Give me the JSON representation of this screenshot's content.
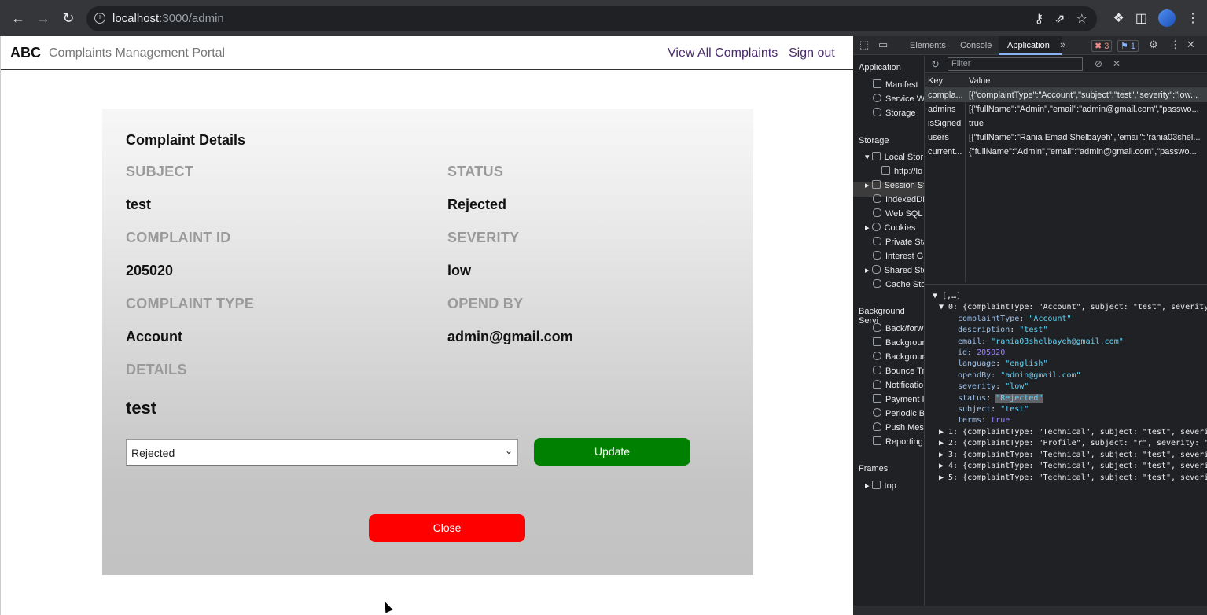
{
  "browser": {
    "url_host": "localhost",
    "url_rest": ":3000/admin"
  },
  "nav": {
    "brand": "ABC",
    "subtitle": "Complaints Management Portal",
    "view_all": "View All Complaints",
    "sign_out": "Sign out"
  },
  "details": {
    "title": "Complaint Details",
    "subject_label": "SUBJECT",
    "subject": "test",
    "status_label": "STATUS",
    "status": "Rejected",
    "id_label": "COMPLAINT ID",
    "id": "205020",
    "severity_label": "SEVERITY",
    "severity": "low",
    "type_label": "COMPLAINT TYPE",
    "type": "Account",
    "opened_label": "OPEND BY",
    "opened_by": "admin@gmail.com",
    "details_label": "DETAILS",
    "details": "test",
    "status_select": "Rejected",
    "update_label": "Update",
    "close_label": "Close"
  },
  "devtools": {
    "tabs": [
      "Elements",
      "Console",
      "Application"
    ],
    "errors": "3",
    "messages": "1",
    "filter_placeholder": "Filter",
    "side": {
      "application": "Application",
      "manifest": "Manifest",
      "service_workers": "Service W",
      "storage_item": "Storage",
      "storage": "Storage",
      "local_storage": "Local Stor",
      "local_origin": "http://lo",
      "session": "Session St",
      "indexeddb": "IndexedDI",
      "websql": "Web SQL",
      "cookies": "Cookies",
      "private": "Private Sta",
      "interest": "Interest G",
      "shared": "Shared Sto",
      "cache": "Cache Sto",
      "background": "Background Servi",
      "back_forward": "Back/forw",
      "bg_fetch": "Backgroun",
      "bg_sync": "Backgroun",
      "bounce": "Bounce Tr",
      "notifications": "Notificatio",
      "payment": "Payment I",
      "periodic": "Periodic B",
      "push": "Push Mes",
      "reporting": "Reporting",
      "frames": "Frames",
      "top": "top"
    },
    "kv_head": {
      "key": "Key",
      "value": "Value"
    },
    "kv": [
      {
        "key": "compla...",
        "value": "[{\"complaintType\":\"Account\",\"subject\":\"test\",\"severity\":\"low..."
      },
      {
        "key": "admins",
        "value": "[{\"fullName\":\"Admin\",\"email\":\"admin@gmail.com\",\"passwo..."
      },
      {
        "key": "isSigned",
        "value": "true"
      },
      {
        "key": "users",
        "value": "[{\"fullName\":\"Rania Emad Shelbayeh\",\"email\":\"rania03shel..."
      },
      {
        "key": "current...",
        "value": "{\"fullName\":\"Admin\",\"email\":\"admin@gmail.com\",\"passwo..."
      }
    ],
    "tree_root": "▼ [,…]",
    "tree_0": "▼ 0: {complaintType: \"Account\", subject: \"test\", severity",
    "props": [
      {
        "k": "complaintType",
        "v": "\"Account\"",
        "t": "s"
      },
      {
        "k": "description",
        "v": "\"test\"",
        "t": "s"
      },
      {
        "k": "email",
        "v": "\"rania03shelbayeh@gmail.com\"",
        "t": "s"
      },
      {
        "k": "id",
        "v": "205020",
        "t": "n"
      },
      {
        "k": "language",
        "v": "\"english\"",
        "t": "s"
      },
      {
        "k": "opendBy",
        "v": "\"admin@gmail.com\"",
        "t": "s"
      },
      {
        "k": "severity",
        "v": "\"low\"",
        "t": "s"
      },
      {
        "k": "status",
        "v": "\"Rejected\"",
        "t": "s"
      },
      {
        "k": "subject",
        "v": "\"test\"",
        "t": "s"
      },
      {
        "k": "terms",
        "v": "true",
        "t": "b"
      }
    ],
    "collapsed": [
      "▶ 1: {complaintType: \"Technical\", subject: \"test\", severi",
      "▶ 2: {complaintType: \"Profile\", subject: \"r\", severity: \"",
      "▶ 3: {complaintType: \"Technical\", subject: \"test\", severi",
      "▶ 4: {complaintType: \"Technical\", subject: \"test\", severi",
      "▶ 5: {complaintType: \"Technical\", subject: \"test\", severi"
    ]
  }
}
